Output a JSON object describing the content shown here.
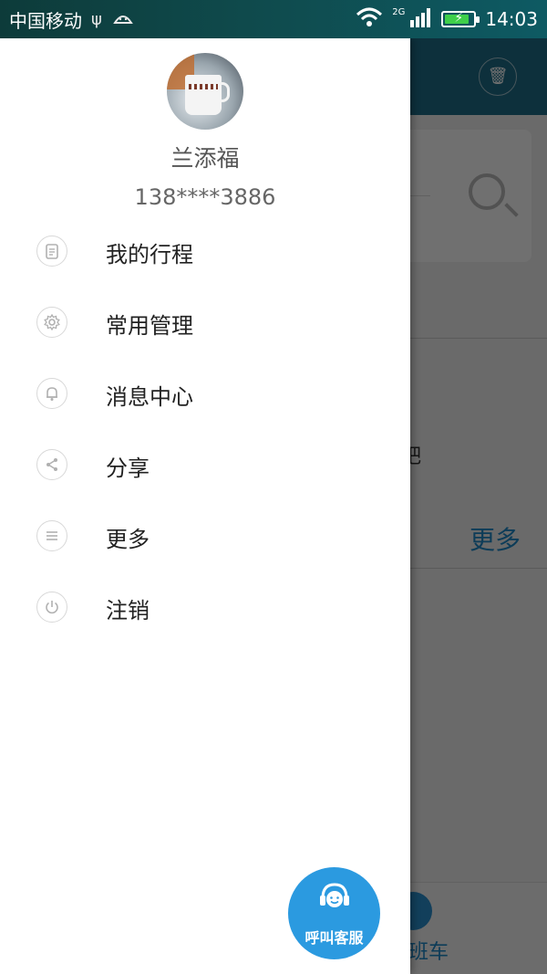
{
  "status_bar": {
    "carrier": "中国移动",
    "network_type": "2G",
    "time": "14:03",
    "battery_level": 0.85,
    "icons": [
      "usb-icon",
      "android-debug-icon",
      "wifi-icon",
      "signal-icon",
      "battery-charging-icon"
    ]
  },
  "drawer": {
    "user": {
      "name": "兰添福",
      "phone": "138****3886"
    },
    "menu": [
      {
        "label": "我的行程",
        "icon": "clipboard-icon"
      },
      {
        "label": "常用管理",
        "icon": "gear-icon"
      },
      {
        "label": "消息中心",
        "icon": "bell-icon"
      },
      {
        "label": "分享",
        "icon": "share-icon"
      },
      {
        "label": "更多",
        "icon": "list-icon"
      },
      {
        "label": "注销",
        "icon": "power-icon"
      }
    ],
    "service_button": {
      "label": "呼叫客服",
      "icon": "headset-icon"
    }
  },
  "background_app": {
    "partial_hint": "吧",
    "more_label": "更多",
    "tab_label": "班车"
  },
  "colors": {
    "accent": "#2b9ae0",
    "header": "#1e6f8a"
  }
}
